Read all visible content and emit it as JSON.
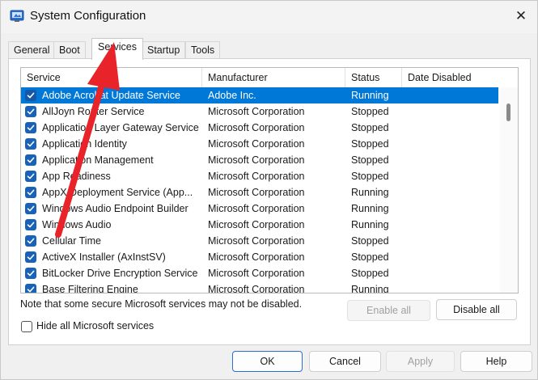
{
  "window": {
    "title": "System Configuration",
    "close_glyph": "✕",
    "icon": "msconfig-icon"
  },
  "tabs": [
    {
      "label": "General",
      "active": false
    },
    {
      "label": "Boot",
      "active": false
    },
    {
      "label": "Services",
      "active": true
    },
    {
      "label": "Startup",
      "active": false
    },
    {
      "label": "Tools",
      "active": false
    }
  ],
  "columns": {
    "service": "Service",
    "manufacturer": "Manufacturer",
    "status": "Status",
    "date_disabled": "Date Disabled"
  },
  "services": [
    {
      "name": "Adobe Acrobat Update Service",
      "manufacturer": "Adobe Inc.",
      "status": "Running",
      "date_disabled": "",
      "checked": true,
      "selected": true
    },
    {
      "name": "AllJoyn Router Service",
      "manufacturer": "Microsoft Corporation",
      "status": "Stopped",
      "date_disabled": "",
      "checked": true,
      "selected": false
    },
    {
      "name": "Application Layer Gateway Service",
      "manufacturer": "Microsoft Corporation",
      "status": "Stopped",
      "date_disabled": "",
      "checked": true,
      "selected": false
    },
    {
      "name": "Application Identity",
      "manufacturer": "Microsoft Corporation",
      "status": "Stopped",
      "date_disabled": "",
      "checked": true,
      "selected": false
    },
    {
      "name": "Application Management",
      "manufacturer": "Microsoft Corporation",
      "status": "Stopped",
      "date_disabled": "",
      "checked": true,
      "selected": false
    },
    {
      "name": "App Readiness",
      "manufacturer": "Microsoft Corporation",
      "status": "Stopped",
      "date_disabled": "",
      "checked": true,
      "selected": false
    },
    {
      "name": "AppX Deployment Service (App...",
      "manufacturer": "Microsoft Corporation",
      "status": "Running",
      "date_disabled": "",
      "checked": true,
      "selected": false
    },
    {
      "name": "Windows Audio Endpoint Builder",
      "manufacturer": "Microsoft Corporation",
      "status": "Running",
      "date_disabled": "",
      "checked": true,
      "selected": false
    },
    {
      "name": "Windows Audio",
      "manufacturer": "Microsoft Corporation",
      "status": "Running",
      "date_disabled": "",
      "checked": true,
      "selected": false
    },
    {
      "name": "Cellular Time",
      "manufacturer": "Microsoft Corporation",
      "status": "Stopped",
      "date_disabled": "",
      "checked": true,
      "selected": false
    },
    {
      "name": "ActiveX Installer (AxInstSV)",
      "manufacturer": "Microsoft Corporation",
      "status": "Stopped",
      "date_disabled": "",
      "checked": true,
      "selected": false
    },
    {
      "name": "BitLocker Drive Encryption Service",
      "manufacturer": "Microsoft Corporation",
      "status": "Stopped",
      "date_disabled": "",
      "checked": true,
      "selected": false
    },
    {
      "name": "Base Filtering Engine",
      "manufacturer": "Microsoft Corporation",
      "status": "Running",
      "date_disabled": "",
      "checked": true,
      "selected": false
    }
  ],
  "note": "Note that some secure Microsoft services may not be disabled.",
  "enable_all": {
    "label": "Enable all",
    "enabled": false
  },
  "disable_all": {
    "label": "Disable all",
    "enabled": true
  },
  "hide_ms": {
    "label": "Hide all Microsoft services",
    "checked": false
  },
  "footer": {
    "ok": "OK",
    "cancel": "Cancel",
    "apply": "Apply",
    "help": "Help"
  },
  "colors": {
    "selection": "#0078d7",
    "checkbox": "#1863b9",
    "annotation_arrow": "#e8232a"
  }
}
